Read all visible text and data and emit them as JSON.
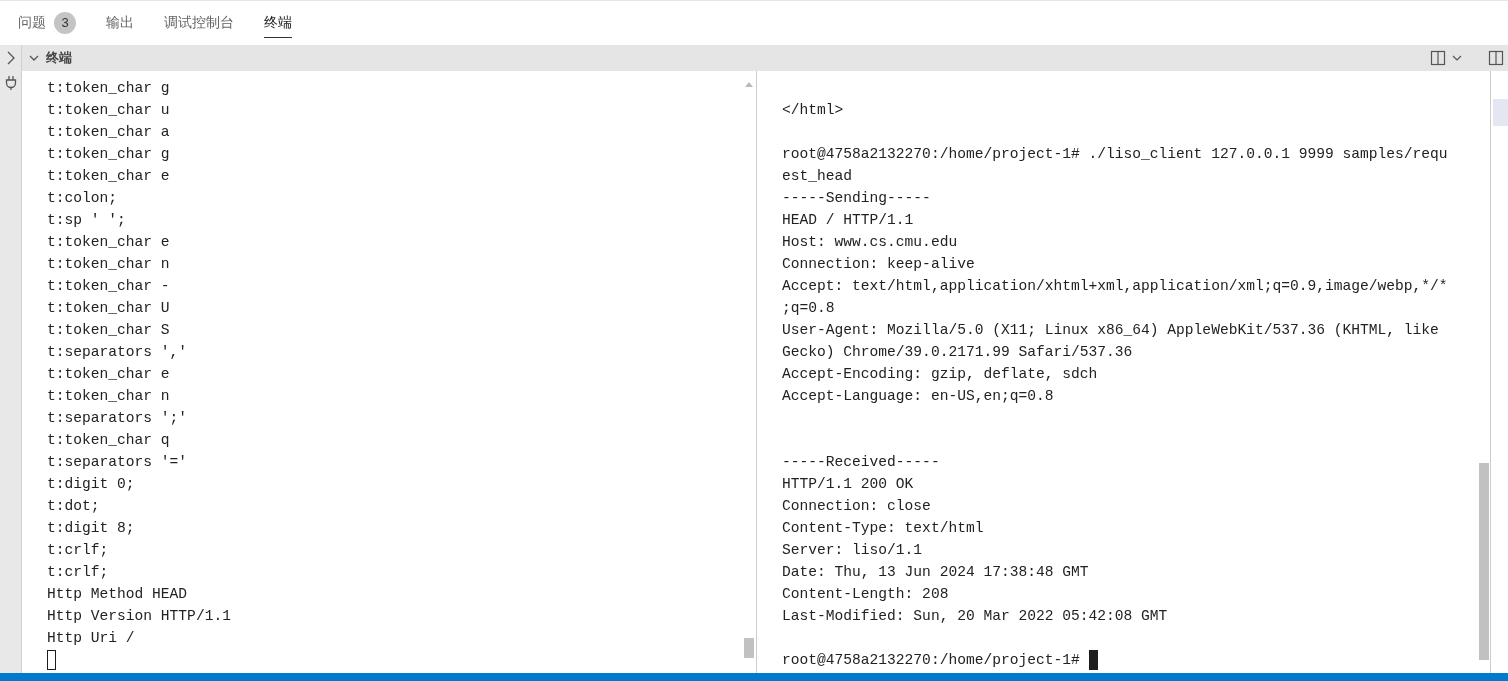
{
  "tabs": [
    {
      "label": "问题",
      "badge": "3",
      "selected": false
    },
    {
      "label": "输出",
      "selected": false
    },
    {
      "label": "调试控制台",
      "selected": false
    },
    {
      "label": "终端",
      "selected": true
    }
  ],
  "section": {
    "title": "终端",
    "expanded": true
  },
  "left_pane": {
    "lines": [
      "t:token_char g",
      "t:token_char u",
      "t:token_char a",
      "t:token_char g",
      "t:token_char e",
      "t:colon;",
      "t:sp ' ';",
      "t:token_char e",
      "t:token_char n",
      "t:token_char -",
      "t:token_char U",
      "t:token_char S",
      "t:separators ','",
      "t:token_char e",
      "t:token_char n",
      "t:separators ';'",
      "t:token_char q",
      "t:separators '='",
      "t:digit 0;",
      "t:dot;",
      "t:digit 8;",
      "t:crlf;",
      "t:crlf;",
      "Http Method HEAD",
      "Http Version HTTP/1.1",
      "Http Uri /"
    ],
    "cursor_focused": false
  },
  "right_pane": {
    "lines": [
      {
        "kind": "blank"
      },
      {
        "kind": "text",
        "text": "</html>"
      },
      {
        "kind": "blank"
      },
      {
        "kind": "text",
        "text": "root@4758a2132270:/home/project-1# ./liso_client 127.0.0.1 9999 samples/requ"
      },
      {
        "kind": "text",
        "text": "est_head"
      },
      {
        "kind": "text",
        "text": "-----Sending-----"
      },
      {
        "kind": "text",
        "text": "HEAD / HTTP/1.1"
      },
      {
        "kind": "text",
        "text": "Host: www.cs.cmu.edu"
      },
      {
        "kind": "text",
        "text": "Connection: keep-alive"
      },
      {
        "kind": "text",
        "text": "Accept: text/html,application/xhtml+xml,application/xml;q=0.9,image/webp,*/*"
      },
      {
        "kind": "text",
        "text": ";q=0.8"
      },
      {
        "kind": "text",
        "text": "User-Agent: Mozilla/5.0 (X11; Linux x86_64) AppleWebKit/537.36 (KHTML, like"
      },
      {
        "kind": "text",
        "text": "Gecko) Chrome/39.0.2171.99 Safari/537.36"
      },
      {
        "kind": "text",
        "text": "Accept-Encoding: gzip, deflate, sdch"
      },
      {
        "kind": "text",
        "text": "Accept-Language: en-US,en;q=0.8"
      },
      {
        "kind": "blank"
      },
      {
        "kind": "blank"
      },
      {
        "kind": "text",
        "text": "-----Received-----"
      },
      {
        "kind": "text",
        "text": "HTTP/1.1 200 OK"
      },
      {
        "kind": "text",
        "text": "Connection: close"
      },
      {
        "kind": "text",
        "text": "Content-Type: text/html"
      },
      {
        "kind": "text",
        "text": "Server: liso/1.1"
      },
      {
        "kind": "text",
        "text": "Date: Thu, 13 Jun 2024 17:38:48 GMT"
      },
      {
        "kind": "text",
        "text": "Content-Length: 208"
      },
      {
        "kind": "text",
        "text": "Last-Modified: Sun, 20 Mar 2022 05:42:08 GMT"
      },
      {
        "kind": "blank"
      },
      {
        "kind": "text",
        "text": "root@4758a2132270:/home/project-1# "
      }
    ],
    "cursor_focused": true
  }
}
